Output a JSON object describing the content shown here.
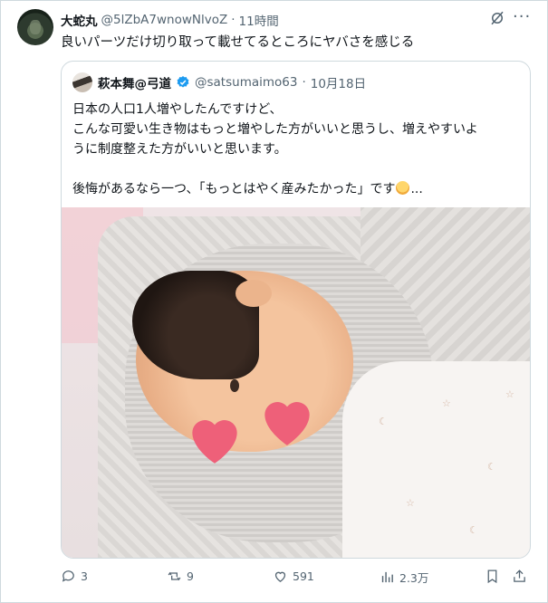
{
  "tweet": {
    "author_name": "大蛇丸",
    "author_handle": "@5lZbA7wnowNlvoZ",
    "separator": "·",
    "time": "11時間",
    "text": "良いパーツだけ切り取って載せてるところにヤバさを感じる"
  },
  "quote": {
    "author_name": "萩本舞@弓道",
    "author_handle": "@satsumaimo63",
    "separator": "·",
    "date": "10月18日",
    "lines": [
      "日本の人口1人増やしたんですけど、",
      "こんな可愛い生き物はもっと増やした方がいいと思うし、増えやすいよ",
      "うに制度整えた方がいいと思います。"
    ],
    "last_line_prefix": "後悔があるなら一つ、「もっとはやく産みたかった」です",
    "last_line_suffix": "..."
  },
  "actions": {
    "replies": "3",
    "retweets": "9",
    "likes": "591",
    "views": "2.3万"
  },
  "icons": {
    "grok": "grok-icon",
    "more": "more-icon",
    "verified": "verified-badge-icon",
    "reply": "reply-icon",
    "retweet": "retweet-icon",
    "like": "like-icon",
    "views": "views-icon",
    "bookmark": "bookmark-icon",
    "share": "share-icon"
  },
  "colors": {
    "text": "#0f1419",
    "muted": "#536471",
    "border": "#cfd9de",
    "verified": "#1d9bf0",
    "heart_sticker": "#ee6079"
  },
  "glyphs": {
    "more": "···"
  }
}
